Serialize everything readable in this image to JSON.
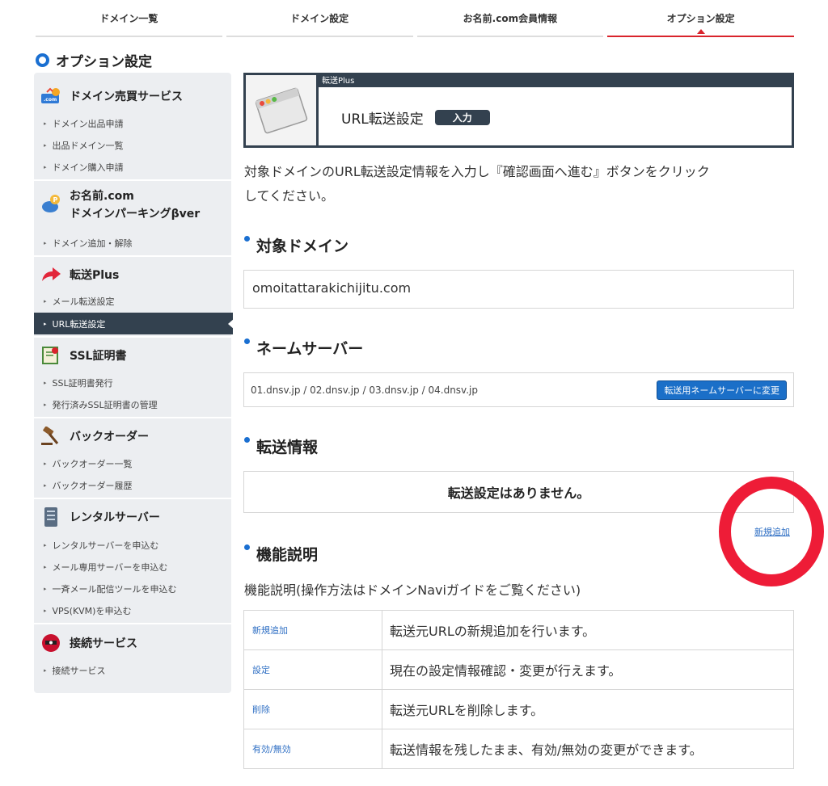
{
  "tabs": [
    {
      "label": "ドメイン一覧",
      "active": false
    },
    {
      "label": "ドメイン設定",
      "active": false
    },
    {
      "label": "お名前.com会員情報",
      "active": false
    },
    {
      "label": "オプション設定",
      "active": true
    }
  ],
  "page_title": "オプション設定",
  "sidebar": {
    "sections": [
      {
        "title": "ドメイン売買サービス",
        "icon": "domain-trade-icon",
        "items": [
          "ドメイン出品申請",
          "出品ドメイン一覧",
          "ドメイン購入申請"
        ]
      },
      {
        "title_line1": "お名前.com",
        "title_line2": "ドメインパーキングβver",
        "icon": "parking-icon",
        "items": [
          "ドメイン追加・解除"
        ]
      },
      {
        "title": "転送Plus",
        "icon": "forward-arrow-icon",
        "items": [
          "メール転送設定",
          "URL転送設定"
        ],
        "active_item": "URL転送設定"
      },
      {
        "title": "SSL証明書",
        "icon": "certificate-icon",
        "items": [
          "SSL証明書発行",
          "発行済みSSL証明書の管理"
        ]
      },
      {
        "title": "バックオーダー",
        "icon": "gavel-icon",
        "items": [
          "バックオーダー一覧",
          "バックオーダー履歴"
        ]
      },
      {
        "title": "レンタルサーバー",
        "icon": "server-icon",
        "items": [
          "レンタルサーバーを申込む",
          "メール専用サーバーを申込む",
          "一斉メール配信ツールを申込む",
          "VPS(KVM)を申込む"
        ]
      },
      {
        "title": "接続サービス",
        "icon": "connection-icon",
        "items": [
          "接続サービス"
        ]
      }
    ]
  },
  "banner": {
    "label": "転送Plus",
    "title": "URL転送設定",
    "badge": "入力"
  },
  "intro_line1": "対象ドメインのURL転送設定情報を入力し『確認画面へ進む』ボタンをクリック",
  "intro_line2": "してください。",
  "target_domain": {
    "heading": "対象ドメイン",
    "value": "omoitattarakichijitu.com"
  },
  "name_server": {
    "heading": "ネームサーバー",
    "value": "01.dnsv.jp / 02.dnsv.jp / 03.dnsv.jp / 04.dnsv.jp",
    "button": "転送用ネームサーバーに変更"
  },
  "forward_info": {
    "heading": "転送情報",
    "empty_message": "転送設定はありません。",
    "new_link": "新規追加"
  },
  "feature": {
    "heading": "機能説明",
    "intro": "機能説明(操作方法はドメインNaviガイドをご覧ください)",
    "rows": [
      {
        "key": "新規追加",
        "desc": "転送元URLの新規追加を行います。"
      },
      {
        "key": "設定",
        "desc": "現在の設定情報確認・変更が行えます。"
      },
      {
        "key": "削除",
        "desc": "転送元URLを削除します。"
      },
      {
        "key": "有効/無効",
        "desc": "転送情報を残したまま、有効/無効の変更ができます。"
      }
    ]
  },
  "colors": {
    "accent_red": "#d9232c",
    "annotation_ring": "#ee1c37",
    "navy": "#33414f",
    "link_blue": "#2f6fc4",
    "button_blue": "#1b6fc8"
  }
}
